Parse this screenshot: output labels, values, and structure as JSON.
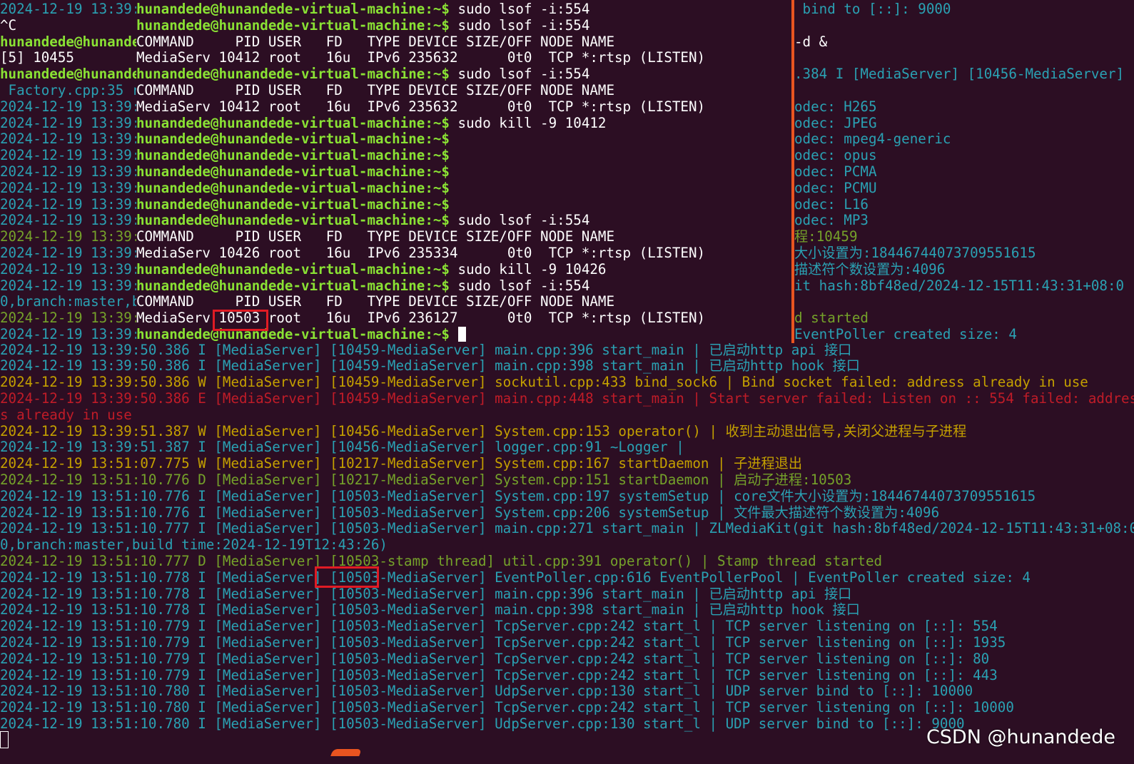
{
  "back_terminal": {
    "lines": [
      {
        "cls": "I",
        "text": "2024-12-19 13:39:50.386 I [MediaServer] [10459-MediaServer] main.cpp:396 start_main | 已启动http api 接口"
      },
      {
        "cls": "I",
        "text": "2024-12-19 13:39:50.386 I [MediaServer] [10459-MediaServer] main.cpp:398 start_main | 已启动http hook 接口"
      },
      {
        "cls": "W",
        "text": "2024-12-19 13:39:50.386 W [MediaServer] [10459-MediaServer] sockutil.cpp:433 bind_sock6 | Bind socket failed: address already in use"
      },
      {
        "cls": "E",
        "text": "2024-12-19 13:39:50.386 E [MediaServer] [10459-MediaServer] main.cpp:448 start_main | Start server failed: Listen on :: 554 failed: addres"
      },
      {
        "cls": "E",
        "text": "s already in use"
      },
      {
        "cls": "W",
        "text": "2024-12-19 13:39:51.387 W [MediaServer] [10456-MediaServer] System.cpp:153 operator() | 收到主动退出信号,关闭父进程与子进程"
      },
      {
        "cls": "I",
        "text": "2024-12-19 13:39:51.387 I [MediaServer] [10456-MediaServer] logger.cpp:91 ~Logger |"
      },
      {
        "cls": "W",
        "text": "2024-12-19 13:51:07.775 W [MediaServer] [10217-MediaServer] System.cpp:167 startDaemon | 子进程退出"
      },
      {
        "cls": "D",
        "text": "2024-12-19 13:51:10.776 D [MediaServer] [10217-MediaServer] System.cpp:151 startDaemon | 启动子进程:10503"
      },
      {
        "cls": "I",
        "text": "2024-12-19 13:51:10.776 I [MediaServer] [10503-MediaServer] System.cpp:197 systemSetup | core文件大小设置为:18446744073709551615"
      },
      {
        "cls": "I",
        "text": "2024-12-19 13:51:10.776 I [MediaServer] [10503-MediaServer] System.cpp:206 systemSetup | 文件最大描述符个数设置为:4096"
      },
      {
        "cls": "I",
        "text": "2024-12-19 13:51:10.777 I [MediaServer] [10503-MediaServer] main.cpp:271 start_main | ZLMediaKit(git hash:8bf48ed/2024-12-15T11:43:31+08:0"
      },
      {
        "cls": "I",
        "text": "0,branch:master,build time:2024-12-19T12:43:26)"
      },
      {
        "cls": "D",
        "text": "2024-12-19 13:51:10.777 D [MediaServer] [10503-stamp thread] util.cpp:391 operator() | Stamp thread started"
      },
      {
        "cls": "I",
        "text": "2024-12-19 13:51:10.778 I [MediaServer] [10503-MediaServer] EventPoller.cpp:616 EventPollerPool | EventPoller created size: 4"
      },
      {
        "cls": "I",
        "text": "2024-12-19 13:51:10.778 I [MediaServer] [10503-MediaServer] main.cpp:396 start_main | 已启动http api 接口"
      },
      {
        "cls": "I",
        "text": "2024-12-19 13:51:10.778 I [MediaServer] [10503-MediaServer] main.cpp:398 start_main | 已启动http hook 接口"
      },
      {
        "cls": "I",
        "text": "2024-12-19 13:51:10.779 I [MediaServer] [10503-MediaServer] TcpServer.cpp:242 start_l | TCP server listening on [::]: 554"
      },
      {
        "cls": "I",
        "text": "2024-12-19 13:51:10.779 I [MediaServer] [10503-MediaServer] TcpServer.cpp:242 start_l | TCP server listening on [::]: 1935"
      },
      {
        "cls": "I",
        "text": "2024-12-19 13:51:10.779 I [MediaServer] [10503-MediaServer] TcpServer.cpp:242 start_l | TCP server listening on [::]: 80"
      },
      {
        "cls": "I",
        "text": "2024-12-19 13:51:10.779 I [MediaServer] [10503-MediaServer] TcpServer.cpp:242 start_l | TCP server listening on [::]: 443"
      },
      {
        "cls": "I",
        "text": "2024-12-19 13:51:10.780 I [MediaServer] [10503-MediaServer] UdpServer.cpp:130 start_l | UDP server bind to [::]: 10000"
      },
      {
        "cls": "I",
        "text": "2024-12-19 13:51:10.780 I [MediaServer] [10503-MediaServer] TcpServer.cpp:242 start_l | TCP server listening on [::]: 10000"
      },
      {
        "cls": "I",
        "text": "2024-12-19 13:51:10.780 I [MediaServer] [10503-MediaServer] UdpServer.cpp:130 start_l | UDP server bind to [::]: 9000"
      }
    ]
  },
  "right_pane": {
    "lines": [
      {
        "c": "c-i",
        "text": " bind to [::]: 9000"
      },
      {
        "c": "c-plain",
        "text": ""
      },
      {
        "c": "c-plain",
        "text": "-d &"
      },
      {
        "c": "c-plain",
        "text": ""
      },
      {
        "c": "c-i",
        "text": ".384 I [MediaServer] [10456-MediaServer]"
      },
      {
        "c": "c-plain",
        "text": ""
      },
      {
        "c": "c-i",
        "text": "odec: H265"
      },
      {
        "c": "c-i",
        "text": "odec: JPEG"
      },
      {
        "c": "c-i",
        "text": "odec: mpeg4-generic"
      },
      {
        "c": "c-i",
        "text": "odec: opus"
      },
      {
        "c": "c-i",
        "text": "odec: PCMA"
      },
      {
        "c": "c-i",
        "text": "odec: PCMU"
      },
      {
        "c": "c-i",
        "text": "odec: L16"
      },
      {
        "c": "c-i",
        "text": "odec: MP3"
      },
      {
        "c": "c-d",
        "text": "程:10459"
      },
      {
        "c": "c-i",
        "text": "大小设置为:18446744073709551615"
      },
      {
        "c": "c-i",
        "text": "描述符个数设置为:4096"
      },
      {
        "c": "c-i",
        "text": "it hash:8bf48ed/2024-12-15T11:43:31+08:0"
      },
      {
        "c": "c-plain",
        "text": ""
      },
      {
        "c": "c-d",
        "text": "d started"
      },
      {
        "c": "c-i",
        "text": "EventPoller created size: 4"
      }
    ]
  },
  "left_strip": {
    "lines": [
      {
        "c": "",
        "text": "2024-12-19 13:39:"
      },
      {
        "c": "plain",
        "text": "^C"
      },
      {
        "c": "g",
        "text": "hunandede@hunande"
      },
      {
        "c": "plain",
        "text": "[5] 10455"
      },
      {
        "c": "g",
        "text": "hunandede@hunande"
      },
      {
        "c": "",
        "text": " Factory.cpp:35 r"
      },
      {
        "c": "",
        "text": "2024-12-19 13:39:"
      },
      {
        "c": "",
        "text": "2024-12-19 13:39:"
      },
      {
        "c": "",
        "text": "2024-12-19 13:39:"
      },
      {
        "c": "",
        "text": "2024-12-19 13:39:"
      },
      {
        "c": "",
        "text": "2024-12-19 13:39:"
      },
      {
        "c": "",
        "text": "2024-12-19 13:39:"
      },
      {
        "c": "",
        "text": "2024-12-19 13:39:"
      },
      {
        "c": "",
        "text": "2024-12-19 13:39:"
      },
      {
        "c": "dg",
        "text": "2024-12-19 13:39:"
      },
      {
        "c": "",
        "text": "2024-12-19 13:39:"
      },
      {
        "c": "",
        "text": "2024-12-19 13:39:"
      },
      {
        "c": "",
        "text": "2024-12-19 13:39:"
      },
      {
        "c": "",
        "text": "0,branch:master,b"
      },
      {
        "c": "dg",
        "text": "2024-12-19 13:39:"
      },
      {
        "c": "",
        "text": "2024-12-19 13:39:"
      }
    ]
  },
  "main_terminal": {
    "prompt": "hunandede@hunandede-virtual-machine:~$",
    "lines": [
      {
        "type": "cmd",
        "text": " sudo lsof -i:554"
      },
      {
        "type": "cmd",
        "text": " sudo lsof -i:554"
      },
      {
        "type": "out",
        "text": "COMMAND     PID USER   FD   TYPE DEVICE SIZE/OFF NODE NAME"
      },
      {
        "type": "out",
        "text": "MediaServ 10412 root   16u  IPv6 235632      0t0  TCP *:rtsp (LISTEN)"
      },
      {
        "type": "cmd",
        "text": " sudo lsof -i:554"
      },
      {
        "type": "out",
        "text": "COMMAND     PID USER   FD   TYPE DEVICE SIZE/OFF NODE NAME"
      },
      {
        "type": "out",
        "text": "MediaServ 10412 root   16u  IPv6 235632      0t0  TCP *:rtsp (LISTEN)"
      },
      {
        "type": "cmd",
        "text": " sudo kill -9 10412"
      },
      {
        "type": "cmd",
        "text": ""
      },
      {
        "type": "cmd",
        "text": ""
      },
      {
        "type": "cmd",
        "text": ""
      },
      {
        "type": "cmd",
        "text": ""
      },
      {
        "type": "cmd",
        "text": ""
      },
      {
        "type": "cmd",
        "text": " sudo lsof -i:554"
      },
      {
        "type": "out",
        "text": "COMMAND     PID USER   FD   TYPE DEVICE SIZE/OFF NODE NAME"
      },
      {
        "type": "out",
        "text": "MediaServ 10426 root   16u  IPv6 235334      0t0  TCP *:rtsp (LISTEN)"
      },
      {
        "type": "cmd",
        "text": " sudo kill -9 10426"
      },
      {
        "type": "cmd",
        "text": " sudo lsof -i:554"
      },
      {
        "type": "out",
        "text": "COMMAND     PID USER   FD   TYPE DEVICE SIZE/OFF NODE NAME"
      },
      {
        "type": "out",
        "text": "MediaServ 10503 root   16u  IPv6 236127      0t0  TCP *:rtsp (LISTEN)"
      },
      {
        "type": "cursor",
        "text": " "
      }
    ]
  },
  "watermark": "CSDN @hunandede",
  "colors": {
    "background": "#2c0e23",
    "prompt_green": "#8ae234",
    "info_cyan": "#2aa1b3",
    "warn_yellow": "#c4a000",
    "error_red": "#c01c28",
    "debug_green": "#75a22a",
    "highlight_box": "#e01b24",
    "divider_orange": "#e95420"
  }
}
